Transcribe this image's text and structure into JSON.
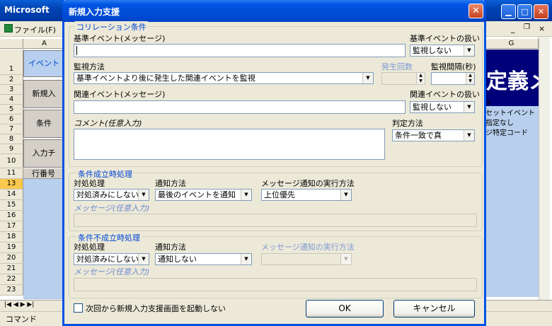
{
  "excel": {
    "title": "Microsoft",
    "menu_file": "ファイル(F)",
    "columns": [
      "A",
      "G"
    ],
    "rows": [
      "1",
      "2",
      "3",
      "4",
      "5",
      "6",
      "7",
      "8",
      "9",
      "10",
      "11",
      "13",
      "14",
      "15",
      "16",
      "17",
      "18",
      "19",
      "20",
      "21",
      "22",
      "23"
    ],
    "sheet_buttons": [
      "イベント",
      "新規入",
      "条件",
      "入力チ"
    ],
    "row11_label": "行番号",
    "right_banner": "定義メン",
    "right_lines": [
      "ト",
      "セットイベント",
      "指定なし",
      "ジ特定コード"
    ],
    "status_text": "コマンド"
  },
  "dialog": {
    "title": "新規入力支援",
    "correlation": {
      "group_title": "コリレーション条件",
      "base_event_label": "基準イベント(メッセージ)",
      "base_event_value": "",
      "base_handling_label": "基準イベントの扱い",
      "base_handling_value": "監視しない",
      "monitor_method_label": "監視方法",
      "monitor_method_value": "基準イベントより後に発生した関連イベントを監視",
      "occurrence_label": "発生回数",
      "interval_label": "監視間隔(秒)",
      "related_event_label": "関連イベント(メッセージ)",
      "related_event_value": "",
      "related_handling_label": "関連イベントの扱い",
      "related_handling_value": "監視しない",
      "comment_label": "コメント(任意入力)",
      "judge_label": "判定方法",
      "judge_value": "条件一致で真"
    },
    "success": {
      "group_title": "条件成立時処理",
      "handling_label": "対処処理",
      "handling_value": "対処済みにしない",
      "notify_label": "通知方法",
      "notify_value": "最後のイベントを通知",
      "exec_label": "メッセージ通知の実行方法",
      "exec_value": "上位優先",
      "message_label": "メッセージ(任意入力)"
    },
    "failure": {
      "group_title": "条件不成立時処理",
      "handling_label": "対処処理",
      "handling_value": "対処済みにしない",
      "notify_label": "通知方法",
      "notify_value": "通知しない",
      "exec_label": "メッセージ通知の実行方法",
      "exec_value": "",
      "message_label": "メッセージ(任意入力)"
    },
    "skip_checkbox_label": "次回から新規入力支援画面を起動しない",
    "ok_label": "OK",
    "cancel_label": "キャンセル",
    "close_glyph": "✕"
  },
  "colors": {
    "titlebar": "#0054e3",
    "group_title": "#0046d5",
    "selection": "#b8d0ee",
    "banner": "#00007a"
  }
}
